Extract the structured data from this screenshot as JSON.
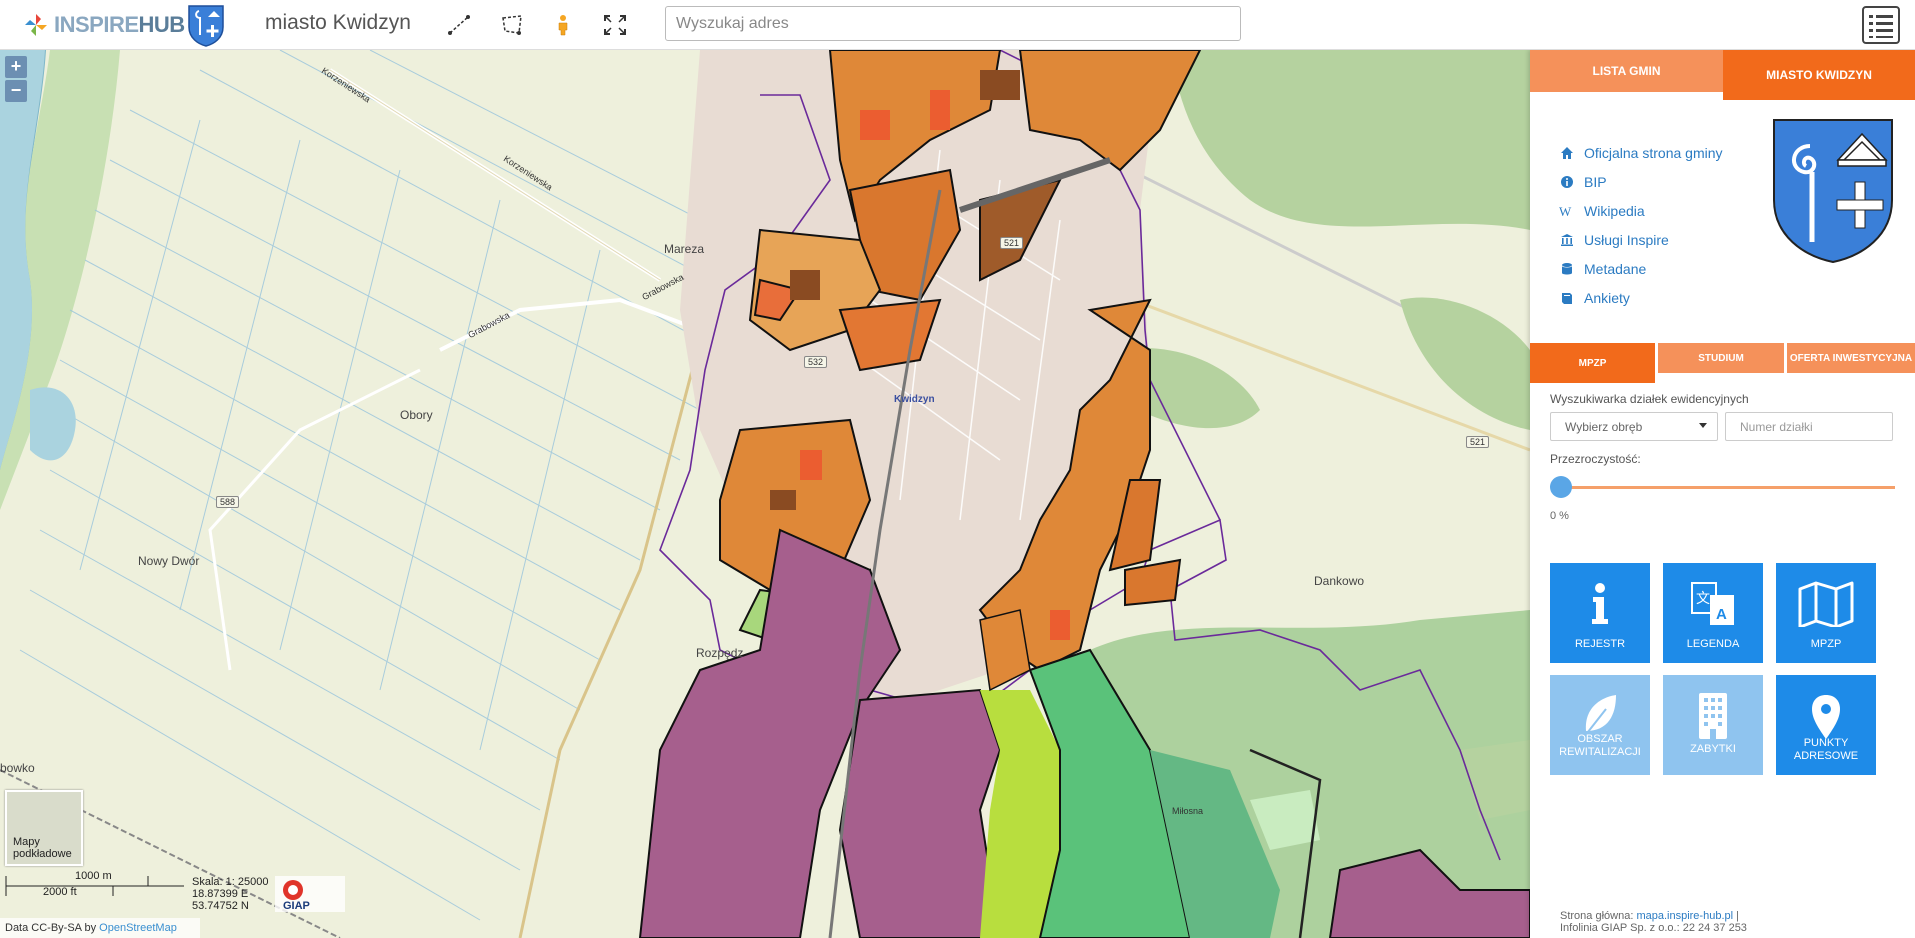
{
  "brand": {
    "part1": "INSPIRE",
    "part2": "HUB"
  },
  "header": {
    "municipality": "miasto Kwidzyn",
    "search_placeholder": "Wyszukaj adres"
  },
  "map": {
    "zoom_in": "+",
    "zoom_out": "−",
    "places": {
      "mareza": "Mareza",
      "obory": "Obory",
      "nowy_dwor": "Nowy Dwór",
      "kwidzyn": "Kwidzyn",
      "dankowo": "Dankowo",
      "rozpedz": "Rozpędz",
      "milosna": "Miłosna",
      "bowko": "bowko"
    },
    "roads": {
      "korzeniewska1": "Korzeniewska",
      "korzeniewska2": "Korzeniewska",
      "grabowska1": "Grabowska",
      "grabowska2": "Grabowska",
      "r532": "532",
      "r588": "588",
      "r521a": "521",
      "r521b": "521"
    },
    "basemap_label": "Mapy podkładowe",
    "scale_m": "1000 m",
    "scale_ft": "2000 ft",
    "scale_ratio": "Skala: 1: 25000",
    "lon": "18.87399 E",
    "lat": "53.74752 N",
    "giap": "GIAP",
    "attribution_prefix": "Data CC-By-SA by",
    "attribution_link": "OpenStreetMap"
  },
  "panel": {
    "tab_lista": "LISTA GMIN",
    "tab_miasto": "MIASTO KWIDZYN",
    "links": [
      {
        "icon": "home-icon",
        "label": "Oficjalna strona gminy"
      },
      {
        "icon": "info-icon",
        "label": "BIP"
      },
      {
        "icon": "wikipedia-icon",
        "label": "Wikipedia"
      },
      {
        "icon": "institution-icon",
        "label": "Usługi Inspire"
      },
      {
        "icon": "database-icon",
        "label": "Metadane"
      },
      {
        "icon": "book-icon",
        "label": "Ankiety"
      }
    ],
    "tab_mpzp": "MPZP",
    "tab_studium": "STUDIUM",
    "tab_oferta": "OFERTA INWESTYCYJNA",
    "search_title": "Wyszukiwarka działek ewidencyjnych",
    "obreb_placeholder": "Wybierz obręb",
    "dzialka_placeholder": "Numer działki",
    "opacity_label": "Przezroczystość:",
    "opacity_value": "0 %",
    "opacity_level": 0,
    "tiles": [
      {
        "icon": "info-icon",
        "label": "REJESTR"
      },
      {
        "icon": "translate-icon",
        "label": "LEGENDA"
      },
      {
        "icon": "map-icon",
        "label": "MPZP"
      },
      {
        "icon": "leaf-icon",
        "label": "OBSZAR REWITALIZACJI"
      },
      {
        "icon": "building-icon",
        "label": "ZABYTKI"
      },
      {
        "icon": "map-pin-icon",
        "label": "PUNKTY ADRESOWE"
      }
    ],
    "footer_line1": "Strona główna:",
    "footer_link": "mapa.inspire-hub.pl",
    "footer_sep": "|",
    "footer_line2": "Infolinia GIAP Sp. z o.o.: 22 24 37 253"
  },
  "colors": {
    "accent_orange": "#f26a1b",
    "light_orange": "#f5915a",
    "tile_blue": "#1e8be8",
    "tile_light_blue": "#8fc4ef",
    "link_blue": "#2b7bc2"
  }
}
